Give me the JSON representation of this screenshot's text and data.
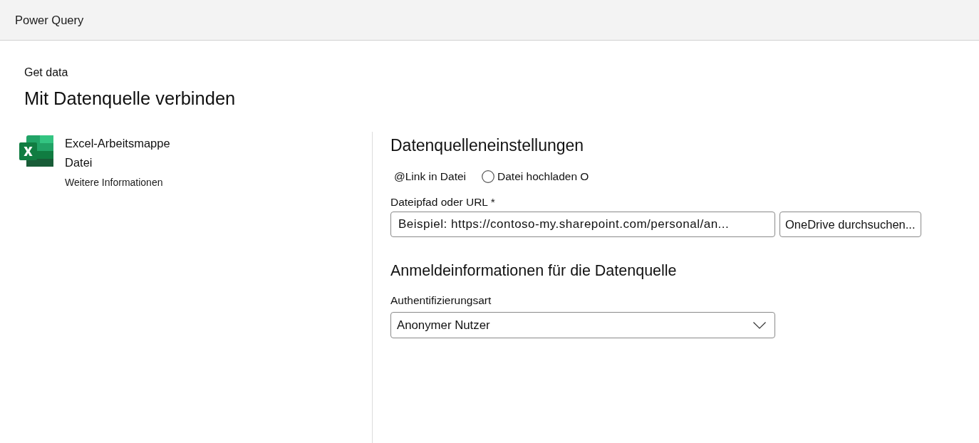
{
  "header": {
    "title": "Power Query"
  },
  "page": {
    "breadcrumb": "Get data",
    "title": "Mit Datenquelle verbinden"
  },
  "connector": {
    "name": "Excel-Arbeitsmappe",
    "category": "Datei",
    "link": "Weitere Informationen"
  },
  "settings": {
    "heading": "Datenquelleneinstellungen",
    "source_options": [
      {
        "kind": "plain",
        "label": "@Link in Datei"
      },
      {
        "kind": "radio",
        "label": "Datei hochladen O",
        "selected": false
      }
    ],
    "path_field": {
      "label": "Dateipfad oder URL *",
      "placeholder": "Beispiel: https://contoso-my.sharepoint.com/personal/an..."
    },
    "browse_button": "OneDrive durchsuchen..."
  },
  "credentials": {
    "heading": "Anmeldeinformationen für die Datenquelle",
    "auth_field": {
      "label": "Authentifizierungsart",
      "value": "Anonymer Nutzer"
    }
  }
}
